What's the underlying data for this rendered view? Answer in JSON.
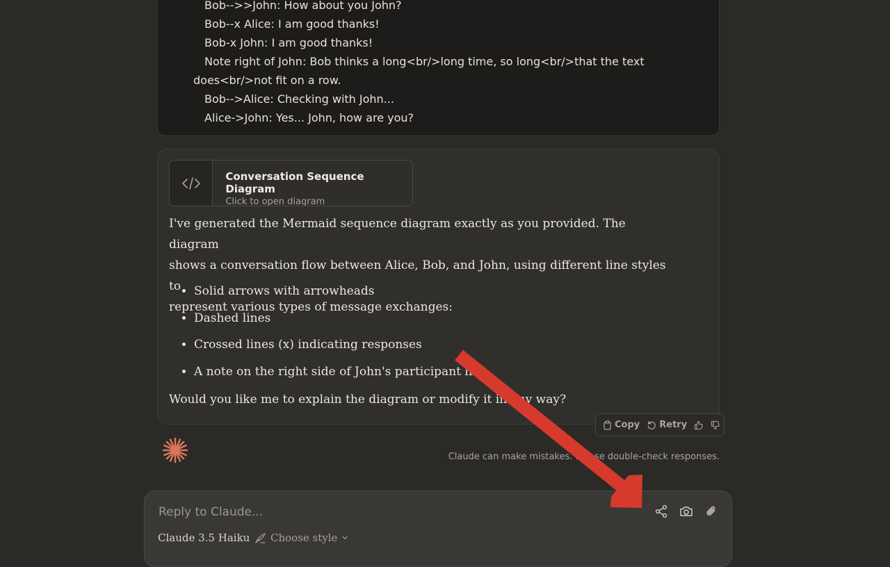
{
  "code_block": {
    "lines": [
      "Bob-->>John: How about you John?",
      "Bob--x Alice: I am good thanks!",
      "Bob-x John: I am good thanks!",
      "Note right of John: Bob thinks a long<br/>long time, so long<br/>that the text",
      "does<br/>not fit on a row.",
      "Bob-->Alice: Checking with John...",
      "Alice->John: Yes... John, how are you?"
    ]
  },
  "artifact": {
    "title": "Conversation Sequence Diagram",
    "subtitle": "Click to open diagram",
    "icon": "code-icon"
  },
  "message": {
    "intro_lines": [
      "I've generated the Mermaid sequence diagram exactly as you provided. The diagram",
      "shows a conversation flow between Alice, Bob, and John, using different line styles to",
      "represent various types of message exchanges:"
    ],
    "bullets": [
      "Solid arrows with arrowheads",
      "Dashed lines",
      "Crossed lines (x) indicating responses",
      "A note on the right side of John's participant line"
    ],
    "closing": "Would you like me to explain the diagram or modify it in any way?"
  },
  "actions": {
    "copy": "Copy",
    "retry": "Retry",
    "thumbs_up_icon": "thumbs-up-icon",
    "thumbs_down_icon": "thumbs-down-icon"
  },
  "disclaimer": "Claude can make mistakes. Please double-check responses.",
  "composer": {
    "placeholder": "Reply to Claude...",
    "model": "Claude 3.5 Haiku",
    "style_label": "Choose style",
    "icons": [
      "share-icon",
      "camera-icon",
      "paperclip-icon"
    ]
  },
  "colors": {
    "background": "#2b2a27",
    "card": "#302f2c",
    "code_bg": "#1d1c1a",
    "claude_orange": "#d97757",
    "annotation_arrow": "#d63a2c"
  }
}
